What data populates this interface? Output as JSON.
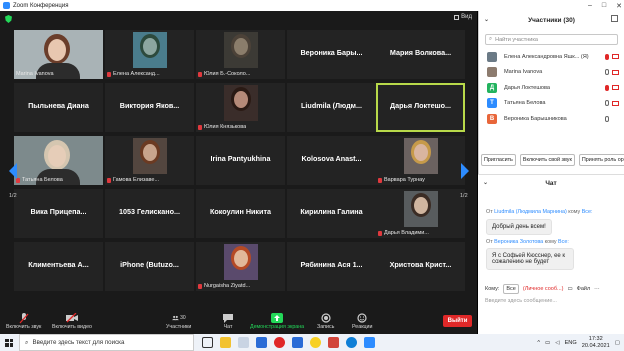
{
  "window": {
    "title": "Zoom Конференция"
  },
  "video": {
    "view_label": "Вид",
    "page_left": "1/2",
    "page_right": "1/2",
    "tiles": [
      {
        "name": "",
        "label": "Marina Ivanova",
        "kind": "video"
      },
      {
        "name": "",
        "label": "Елена Александ...",
        "kind": "photo",
        "muted": true
      },
      {
        "name": "",
        "label": "Юлия Б.-Соколо...",
        "kind": "photo",
        "muted": true
      },
      {
        "name": "Вероника  Бары...",
        "label": "",
        "kind": "name"
      },
      {
        "name": "Мария  Волкова...",
        "label": "",
        "kind": "name"
      },
      {
        "name": "Пыльнева Диана",
        "label": "",
        "kind": "name"
      },
      {
        "name": "Виктория  Яков...",
        "label": "",
        "kind": "name"
      },
      {
        "name": "",
        "label": "Юлия Князькова",
        "kind": "photo",
        "muted": true
      },
      {
        "name": "Liudmila  (Людм...",
        "label": "",
        "kind": "name"
      },
      {
        "name": "Дарья  Локтешо...",
        "label": "",
        "kind": "name",
        "active": true
      },
      {
        "name": "",
        "label": "Татьяна Белова",
        "kind": "video",
        "muted": true
      },
      {
        "name": "",
        "label": "Гамова Елизаве...",
        "kind": "photo",
        "muted": true
      },
      {
        "name": "Irina  Pantyukhina",
        "label": "",
        "kind": "name"
      },
      {
        "name": "Kolosova  Anast...",
        "label": "",
        "kind": "name"
      },
      {
        "name": "",
        "label": "Варвара Турнау",
        "kind": "photo",
        "muted": true
      },
      {
        "name": "Вика  Прицепа...",
        "label": "",
        "kind": "name"
      },
      {
        "name": "1053  Гелискано...",
        "label": "",
        "kind": "name"
      },
      {
        "name": "Кокоулин  Никита",
        "label": "",
        "kind": "name"
      },
      {
        "name": "Кирилина  Галина",
        "label": "",
        "kind": "name"
      },
      {
        "name": "",
        "label": "Дарья Владими...",
        "kind": "photo",
        "muted": true
      },
      {
        "name": "Климентьева  А...",
        "label": "",
        "kind": "name"
      },
      {
        "name": "iPhone  (Butuzo...",
        "label": "",
        "kind": "name"
      },
      {
        "name": "",
        "label": "Nurgaisha Ziyatd...",
        "kind": "photo",
        "muted": true
      },
      {
        "name": "Рябинина  Ася  1...",
        "label": "",
        "kind": "name"
      },
      {
        "name": "Христова  Крист...",
        "label": "",
        "kind": "name"
      }
    ]
  },
  "toolbar": {
    "unmute": "Включить звук",
    "video": "Включить видео",
    "participants": "Участники",
    "participants_count": "30",
    "chat": "Чат",
    "share": "Демонстрация экрана",
    "record": "Запись",
    "reactions": "Реакции",
    "leave": "Выйти"
  },
  "participants": {
    "title": "Участники (30)",
    "search_placeholder": "Найти участника",
    "list": [
      {
        "initial": "",
        "name": "Елена Александровна Яшк...",
        "tag": "(Я)",
        "color": "#6b7a86",
        "mic_muted": true,
        "cam_off": true
      },
      {
        "initial": "",
        "name": "Marina Ivanova",
        "tag": "",
        "color": "#8c7b6e",
        "mic_muted": false,
        "cam_off": true
      },
      {
        "initial": "Д",
        "name": "Дарья Локтешова",
        "tag": "",
        "color": "#22b35e",
        "mic_muted": true,
        "cam_off": true
      },
      {
        "initial": "Т",
        "name": "Татьяна Белова",
        "tag": "",
        "color": "#2d8cff",
        "mic_muted": false,
        "cam_off": true
      },
      {
        "initial": "В",
        "name": "Вероника Барышникова",
        "tag": "",
        "color": "#e8663a",
        "mic_muted": false,
        "cam_off": false
      }
    ],
    "buttons": {
      "invite": "Пригласить",
      "mute_all": "Включить свой звук",
      "claim_host": "Принять роль организатора"
    }
  },
  "chat": {
    "title": "Чат",
    "messages": [
      {
        "from_prefix": "От",
        "from": "Liudmila (Людмила Марнина)",
        "to_prefix": "кому",
        "to": "Все:",
        "text": "Добрый день всем!"
      },
      {
        "from_prefix": "От",
        "from": "Вероника Золотова",
        "to_prefix": "кому",
        "to": "Все:",
        "text": "Я с Софьей Кюсснер, ее к сожалению не будет"
      }
    ],
    "to_label": "Кому:",
    "to_value": "Все",
    "private_label": "(Личное сооб...)",
    "file_label": "Файл",
    "input_placeholder": "Введите здесь сообщение..."
  },
  "taskbar": {
    "search_placeholder": "Введите здесь текст для поиска",
    "lang": "ENG",
    "time": "17:32",
    "date": "20.04.2021"
  }
}
